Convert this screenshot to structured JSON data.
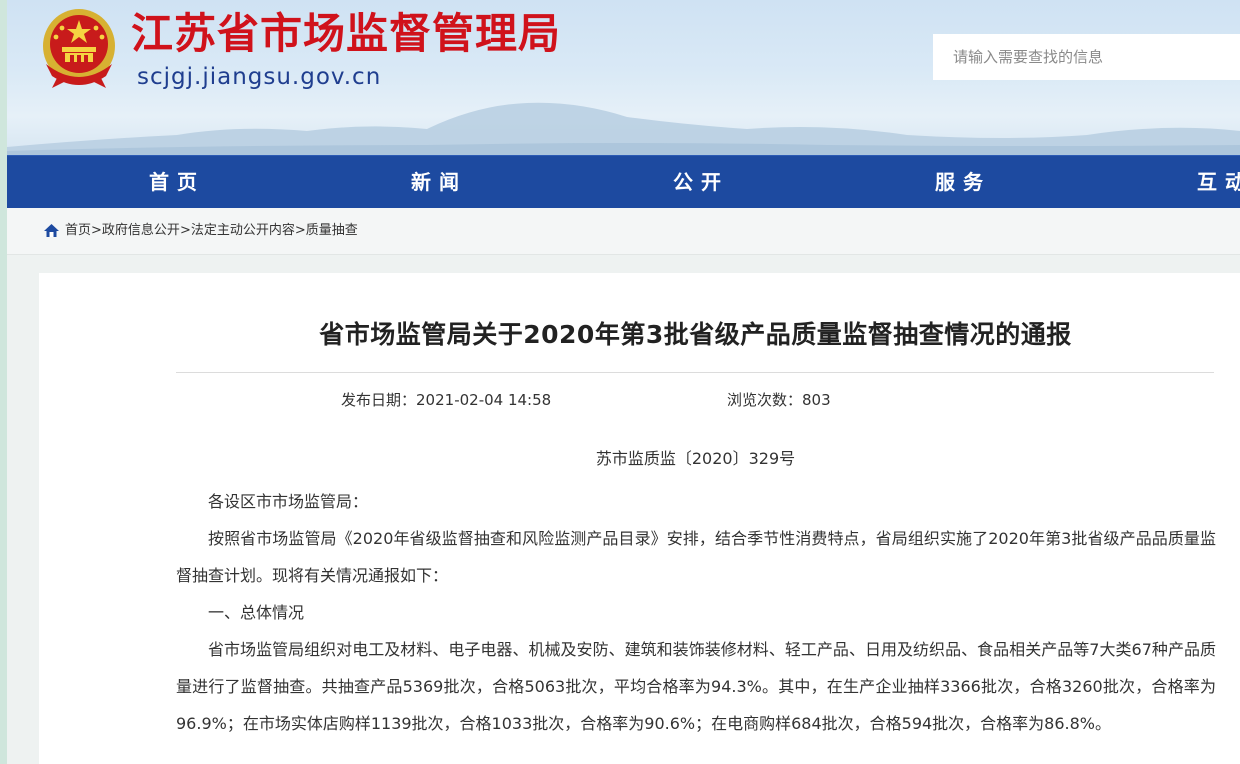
{
  "header": {
    "site_title": "江苏省市场监督管理局",
    "site_domain": "scjgj.jiangsu.gov.cn",
    "search_placeholder": "请输入需要查找的信息",
    "emblem_icon": "national-emblem-icon",
    "brand_color": "#d0121b"
  },
  "nav": {
    "items": [
      {
        "label": "首页"
      },
      {
        "label": "新闻"
      },
      {
        "label": "公开"
      },
      {
        "label": "服务"
      },
      {
        "label": "互动"
      }
    ],
    "bg_color": "#1d4aa0"
  },
  "breadcrumb": {
    "icon": "home-icon",
    "items": [
      "首页",
      "政府信息公开",
      "法定主动公开内容",
      "质量抽查"
    ],
    "separator": ">"
  },
  "article": {
    "title": "省市场监管局关于2020年第3批省级产品质量监督抽查情况的通报",
    "publish_label": "发布日期：",
    "publish_date": "2021-02-04 14:58",
    "views_label": "浏览次数：",
    "views": "803",
    "doc_number": "苏市监质监〔2020〕329号",
    "salutation": "各设区市市场监管局：",
    "paragraphs": [
      "按照省市场监管局《2020年省级监督抽查和风险监测产品目录》安排，结合季节性消费特点，省局组织实施了2020年第3批省级产品品质量监督抽查计划。现将有关情况通报如下：",
      "一、总体情况",
      "省市场监管局组织对电工及材料、电子电器、机械及安防、建筑和装饰装修材料、轻工产品、日用及纺织品、食品相关产品等7大类67种产品质量进行了监督抽查。共抽查产品5369批次，合格5063批次，平均合格率为94.3%。其中，在生产企业抽样3366批次，合格3260批次，合格率为96.9%；在市场实体店购样1139批次，合格1033批次，合格率为90.6%；在电商购样684批次，合格594批次，合格率为86.8%。"
    ]
  }
}
